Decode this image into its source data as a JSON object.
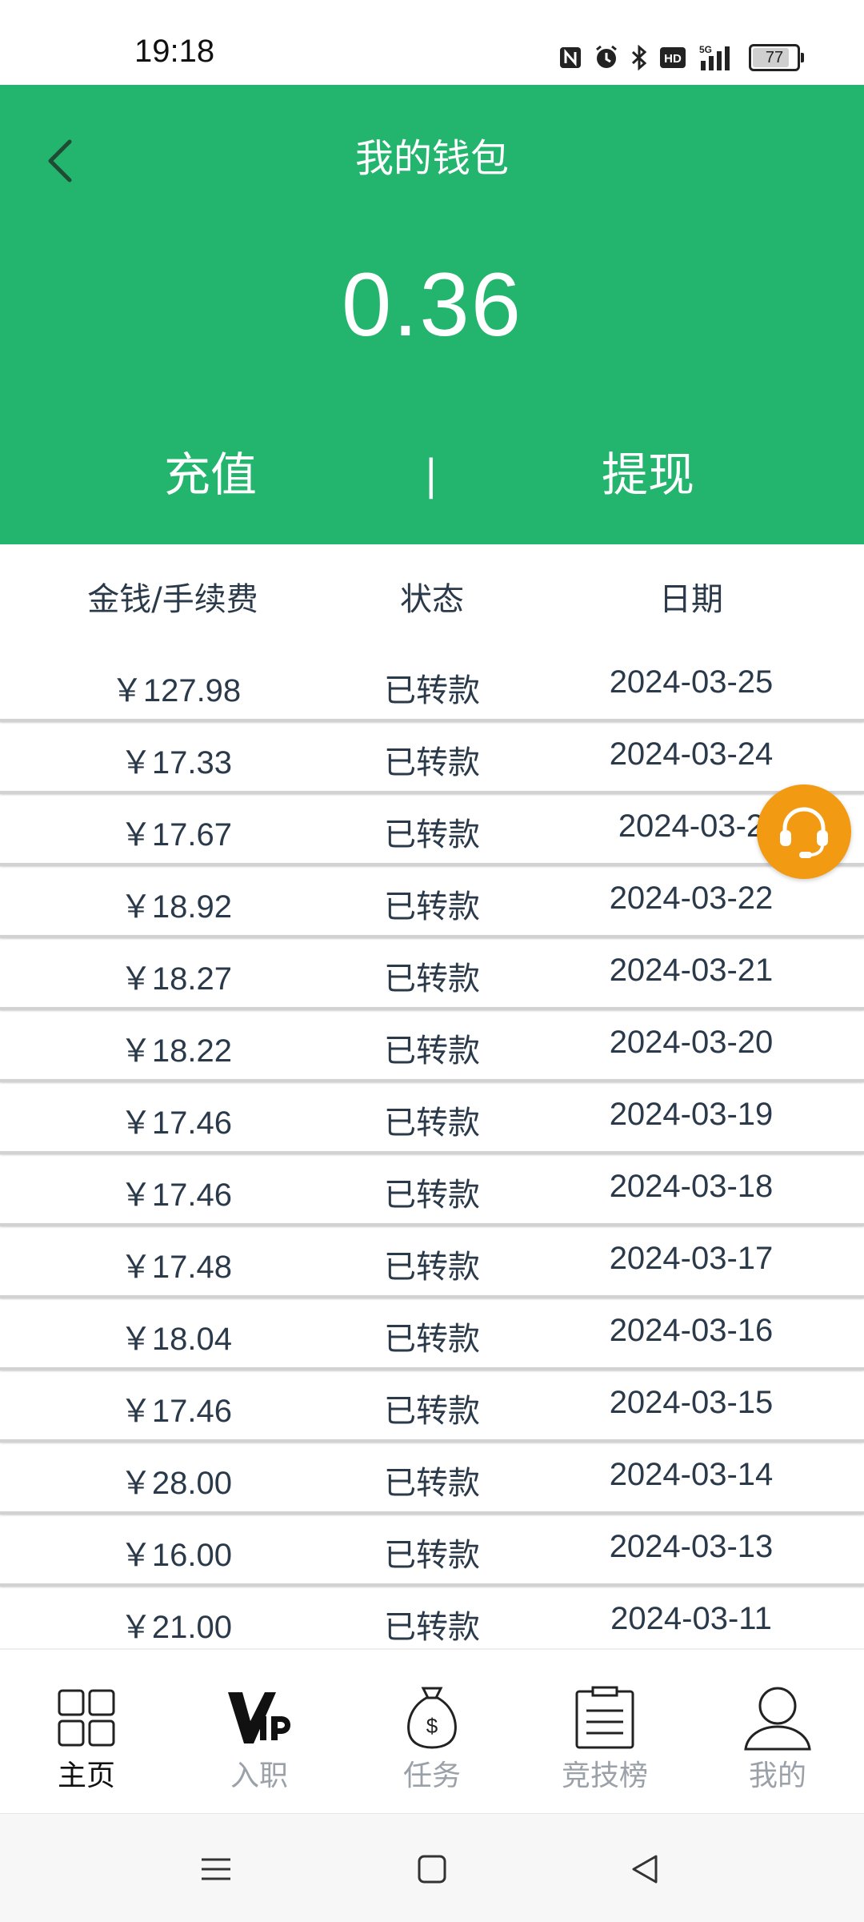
{
  "status_bar": {
    "time": "19:18",
    "icons": [
      "nfc-icon",
      "alarm-icon",
      "bluetooth-icon",
      "hd-icon",
      "5g-signal-icon"
    ],
    "battery": "77"
  },
  "header": {
    "title": "我的钱包",
    "balance": "0.36",
    "recharge_label": "充值",
    "separator": "|",
    "withdraw_label": "提现",
    "color": "#23b56d"
  },
  "table": {
    "columns": [
      "金钱/手续费",
      "状态",
      "日期"
    ],
    "rows": [
      {
        "amount": "￥127.98",
        "status": "已转款",
        "date": "2024-03-25"
      },
      {
        "amount": "￥17.33",
        "status": "已转款",
        "date": "2024-03-24"
      },
      {
        "amount": "￥17.67",
        "status": "已转款",
        "date": "2024-03-2"
      },
      {
        "amount": "￥18.92",
        "status": "已转款",
        "date": "2024-03-22"
      },
      {
        "amount": "￥18.27",
        "status": "已转款",
        "date": "2024-03-21"
      },
      {
        "amount": "￥18.22",
        "status": "已转款",
        "date": "2024-03-20"
      },
      {
        "amount": "￥17.46",
        "status": "已转款",
        "date": "2024-03-19"
      },
      {
        "amount": "￥17.46",
        "status": "已转款",
        "date": "2024-03-18"
      },
      {
        "amount": "￥17.48",
        "status": "已转款",
        "date": "2024-03-17"
      },
      {
        "amount": "￥18.04",
        "status": "已转款",
        "date": "2024-03-16"
      },
      {
        "amount": "￥17.46",
        "status": "已转款",
        "date": "2024-03-15"
      },
      {
        "amount": "￥28.00",
        "status": "已转款",
        "date": "2024-03-14"
      },
      {
        "amount": "￥16.00",
        "status": "已转款",
        "date": "2024-03-13"
      },
      {
        "amount": "￥21.00",
        "status": "已转款",
        "date": "2024-03-11"
      }
    ]
  },
  "support": {
    "icon": "headset-icon",
    "color": "#f29a12"
  },
  "bottom_nav": {
    "items": [
      {
        "label": "主页",
        "icon": "grid-icon",
        "active": true
      },
      {
        "label": "入职",
        "icon": "vip-icon",
        "active": false
      },
      {
        "label": "任务",
        "icon": "money-bag-icon",
        "active": false
      },
      {
        "label": "竞技榜",
        "icon": "clipboard-icon",
        "active": false
      },
      {
        "label": "我的",
        "icon": "user-icon",
        "active": false
      }
    ]
  },
  "system_nav": {
    "icons": [
      "menu-icon",
      "home-square-icon",
      "back-triangle-icon"
    ]
  }
}
